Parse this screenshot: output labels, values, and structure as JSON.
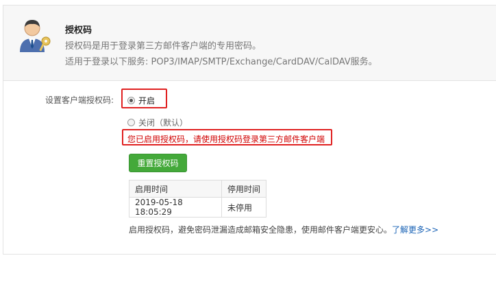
{
  "header": {
    "title": "授权码",
    "desc1": "授权码是用于登录第三方邮件客户端的专用密码。",
    "desc2": "适用于登录以下服务: POP3/IMAP/SMTP/Exchange/CardDAV/CalDAV服务。"
  },
  "setting": {
    "label": "设置客户端授权码:",
    "option_on": "开启",
    "option_off": "关闭（默认）",
    "selected": "开启",
    "message": "您已启用授权码，请使用授权码登录第三方邮件客户端",
    "reset_label": "重置授权码"
  },
  "table": {
    "headers": [
      "启用时间",
      "停用时间"
    ],
    "rows": [
      [
        "2019-05-18 18:05:29",
        "未停用"
      ]
    ]
  },
  "footer": {
    "text": "启用授权码，避免密码泄漏造成邮箱安全隐患，使用邮件客户端更安心。",
    "link": "了解更多>>"
  },
  "colors": {
    "accent_green": "#44a93a",
    "highlight_red": "#e02020",
    "link_blue": "#1a63b6"
  },
  "icons": {
    "avatar": "user-key-icon"
  }
}
